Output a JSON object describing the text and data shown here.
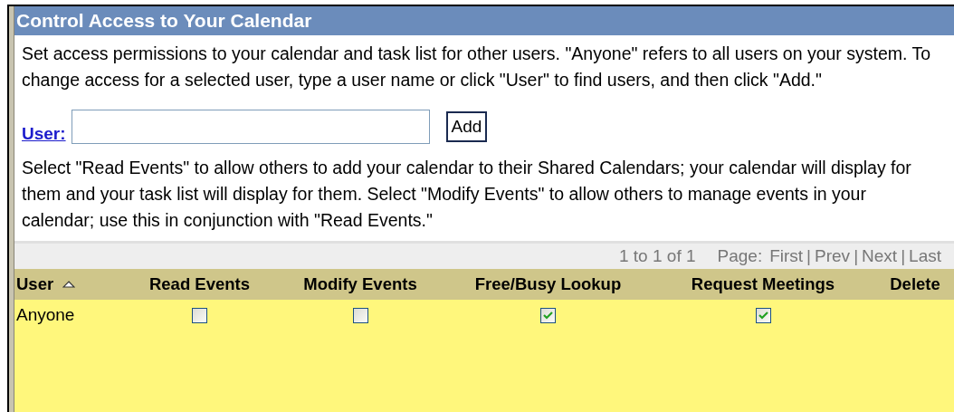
{
  "title": "Control Access to Your Calendar",
  "intro": "Set access permissions to your calendar and task list for other users. \"Anyone\" refers to all users on your system. To change access for a selected user, type a user name or click \"User\" to find users, and then click \"Add.\"",
  "user_field": {
    "label": "User:",
    "button": "Add"
  },
  "explanation": "Select \"Read Events\" to allow others to add your calendar to their Shared Calendars; your calendar will display for them and your task list will display for them. Select \"Modify Events\" to allow others to manage events in your calendar; use this in conjunction with \"Read Events.\"",
  "pagination": {
    "count": "1 to 1 of 1",
    "page_label": "Page:",
    "links": [
      "First",
      "Prev",
      "Next",
      "Last"
    ],
    "separator": "|"
  },
  "table": {
    "columns": [
      "User",
      "Read Events",
      "Modify Events",
      "Free/Busy Lookup",
      "Request Meetings",
      "Delete"
    ],
    "rows": [
      {
        "user": "Anyone",
        "checks": [
          false,
          false,
          true,
          true
        ]
      }
    ]
  }
}
